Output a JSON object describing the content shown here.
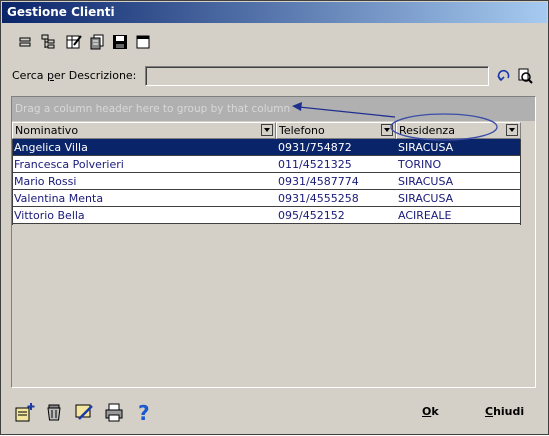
{
  "window": {
    "title": "Gestione Clienti"
  },
  "toolbar": {
    "icons": [
      "tree-collapse-icon",
      "tree-expand-icon",
      "grid-edit-icon",
      "copy-stack-icon",
      "save-icon",
      "window-icon"
    ]
  },
  "search": {
    "label_prefix": "Cerca ",
    "label_accel": "p",
    "label_suffix": "er Descrizione:",
    "value": "",
    "undo_icon": "undo-icon",
    "find_icon": "search-zoom-icon"
  },
  "grid": {
    "group_hint": "Drag a column header here to group by that column",
    "columns": [
      "Nominativo",
      "Telefono",
      "Residenza"
    ],
    "rows": [
      {
        "nominativo": "Angelica Villa",
        "telefono": "0931/754872",
        "residenza": "SIRACUSA",
        "selected": true
      },
      {
        "nominativo": "Francesca Polverieri",
        "telefono": "011/4521325",
        "residenza": "TORINO",
        "selected": false
      },
      {
        "nominativo": "Mario Rossi",
        "telefono": "0931/4587774",
        "residenza": "SIRACUSA",
        "selected": false
      },
      {
        "nominativo": "Valentina Menta",
        "telefono": "0931/4555258",
        "residenza": "SIRACUSA",
        "selected": false
      },
      {
        "nominativo": "Vittorio Bella",
        "telefono": "095/452152",
        "residenza": "ACIREALE",
        "selected": false
      }
    ]
  },
  "footer": {
    "icons": [
      "new-document-icon",
      "delete-bin-icon",
      "edit-pencil-icon",
      "print-icon",
      "help-icon"
    ],
    "ok_accel": "O",
    "ok_rest": "k",
    "close_accel": "C",
    "close_rest": "hiudi"
  },
  "colors": {
    "selection": "#0a246a",
    "row_text": "#1a1a7a",
    "annotation": "#1f2f8f"
  }
}
